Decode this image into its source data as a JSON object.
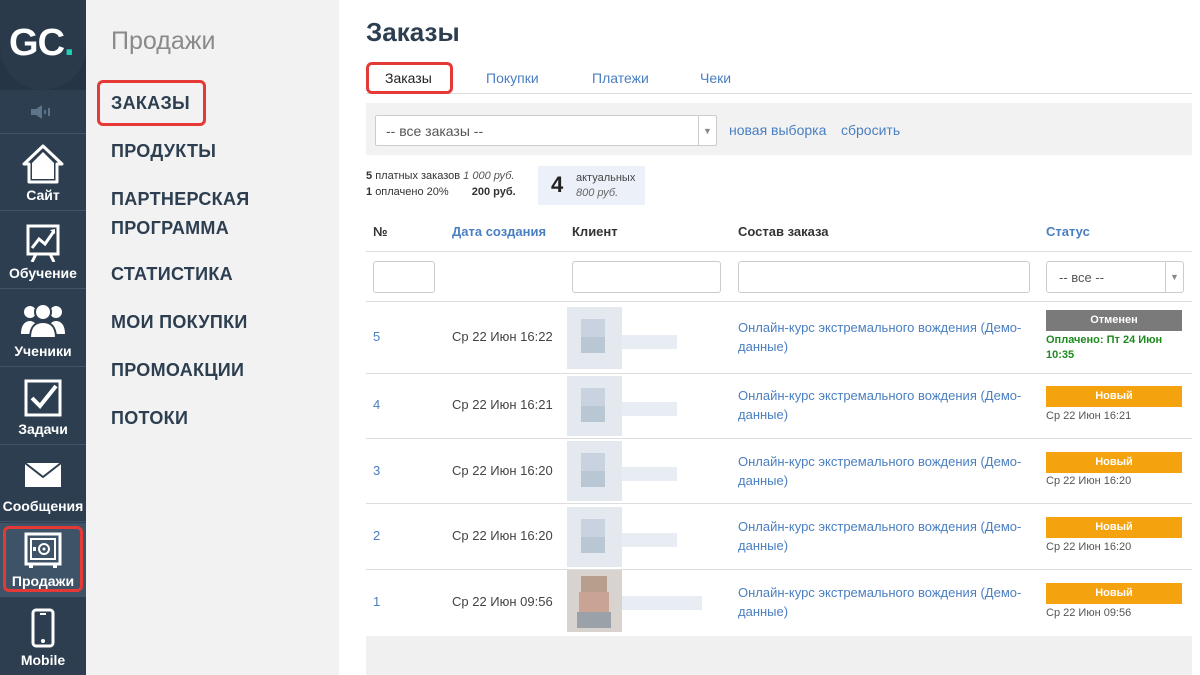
{
  "app": {
    "logo_text_g": "G",
    "logo_text_c": "C",
    "logo_text_dot": ".",
    "accent": "#1fd0b4"
  },
  "iconbar": {
    "items": [
      {
        "label": "Сайт",
        "icon": "house-icon"
      },
      {
        "label": "Обучение",
        "icon": "chart-board-icon"
      },
      {
        "label": "Ученики",
        "icon": "users-icon"
      },
      {
        "label": "Задачи",
        "icon": "checkbox-icon"
      },
      {
        "label": "Сообщения",
        "icon": "envelope-icon"
      },
      {
        "label": "Продажи",
        "icon": "safe-icon",
        "active": true
      },
      {
        "label": "Mobile",
        "icon": "phone-icon"
      }
    ]
  },
  "submenu": {
    "title": "Продажи",
    "items": [
      {
        "label": "ЗАКАЗЫ",
        "active": true
      },
      {
        "label": "ПРОДУКТЫ"
      },
      {
        "label": "ПАРТНЕРСКАЯ ПРОГРАММА"
      },
      {
        "label": "СТАТИСТИКА"
      },
      {
        "label": "МОИ ПОКУПКИ"
      },
      {
        "label": "ПРОМОАКЦИИ"
      },
      {
        "label": "ПОТОКИ"
      }
    ]
  },
  "main": {
    "title": "Заказы",
    "tabs": [
      {
        "label": "Заказы",
        "active": true
      },
      {
        "label": "Покупки"
      },
      {
        "label": "Платежи"
      },
      {
        "label": "Чеки"
      }
    ],
    "filter": {
      "select_value": "-- все заказы --",
      "new_selection": "новая выборка",
      "reset": "сбросить"
    },
    "stats": {
      "paid_count": "5",
      "paid_label": "платных заказов",
      "paid_sum": "1 000 руб.",
      "paid20_count": "1",
      "paid20_label": "оплачено 20%",
      "paid20_sum": "200 руб.",
      "actual_count": "4",
      "actual_label": "актуальных",
      "actual_sum": "800 руб."
    },
    "table": {
      "headers": {
        "num": "№",
        "date": "Дата создания",
        "client": "Клиент",
        "composition": "Состав заказа",
        "status": "Статус"
      },
      "status_filter": "-- все --",
      "rows": [
        {
          "num": "5",
          "date": "Ср 22 Июн 16:22",
          "composition": "Онлайн-курс экстремального вождения (Демо-данные)",
          "status": "Отменен",
          "status_color": "#7a7a7a",
          "status_sub": "Оплачено: Пт 24 Июн 10:35"
        },
        {
          "num": "4",
          "date": "Ср 22 Июн 16:21",
          "composition": "Онлайн-курс экстремального вождения (Демо-данные)",
          "status": "Новый",
          "status_color": "#f5a20f",
          "status_sub": "Ср 22 Июн 16:21"
        },
        {
          "num": "3",
          "date": "Ср 22 Июн 16:20",
          "composition": "Онлайн-курс экстремального вождения (Демо-данные)",
          "status": "Новый",
          "status_color": "#f5a20f",
          "status_sub": "Ср 22 Июн 16:20"
        },
        {
          "num": "2",
          "date": "Ср 22 Июн 16:20",
          "composition": "Онлайн-курс экстремального вождения (Демо-данные)",
          "status": "Новый",
          "status_color": "#f5a20f",
          "status_sub": "Ср 22 Июн 16:20"
        },
        {
          "num": "1",
          "date": "Ср 22 Июн 09:56",
          "composition": "Онлайн-курс экстремального вождения (Демо-данные)",
          "status": "Новый",
          "status_color": "#f5a20f",
          "status_sub": "Ср 22 Июн 09:56"
        }
      ]
    }
  }
}
